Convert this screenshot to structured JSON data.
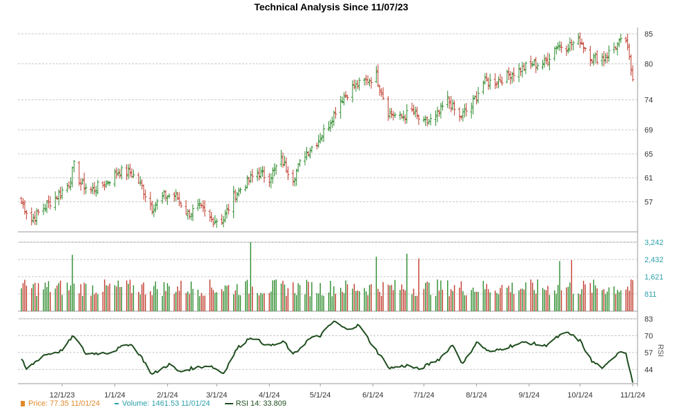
{
  "chart_data": {
    "title": "Technical Analysis Since 11/07/23",
    "type": "ohlc",
    "colors": {
      "up": "#2a8a2a",
      "down": "#c0392b",
      "rsi": "#1e4d1e",
      "price_label": "#e08a2a",
      "volume_label": "#2a9fa8",
      "grid": "#c8c8c8"
    },
    "price_panel": {
      "yticks": [
        57,
        61,
        65,
        69,
        74,
        80,
        85
      ],
      "ylim": [
        52,
        85
      ]
    },
    "volume_panel": {
      "yticks": [
        811,
        1621,
        2432,
        3242
      ],
      "ytick_labels": [
        "811",
        "1,621",
        "2,432",
        "3,242"
      ],
      "ylim": [
        0,
        3242
      ]
    },
    "rsi_panel": {
      "label": "RSI",
      "yticks": [
        44,
        57,
        70,
        83
      ],
      "ylim": [
        33,
        83
      ]
    },
    "x_ticks": [
      "12/1/23",
      "1/1/24",
      "2/1/24",
      "3/1/24",
      "4/1/24",
      "5/1/24",
      "6/1/24",
      "7/1/24",
      "8/1/24",
      "9/1/24",
      "10/1/24",
      "11/1/24"
    ],
    "price_anchors": [
      [
        "11/7/23",
        57
      ],
      [
        "11/13/23",
        54
      ],
      [
        "11/20/23",
        56
      ],
      [
        "11/28/23",
        58
      ],
      [
        "12/5/23",
        60
      ],
      [
        "12/8/23",
        63
      ],
      [
        "12/12/23",
        60
      ],
      [
        "12/18/23",
        59
      ],
      [
        "12/26/23",
        60
      ],
      [
        "1/3/24",
        62
      ],
      [
        "1/10/24",
        62
      ],
      [
        "1/16/24",
        60
      ],
      [
        "1/23/24",
        56
      ],
      [
        "1/30/24",
        58
      ],
      [
        "2/2/24",
        58
      ],
      [
        "2/6/24",
        58
      ],
      [
        "2/13/24",
        55
      ],
      [
        "2/20/24",
        56
      ],
      [
        "2/27/24",
        54
      ],
      [
        "3/5/24",
        54
      ],
      [
        "3/11/24",
        58
      ],
      [
        "3/18/24",
        60
      ],
      [
        "3/25/24",
        62
      ],
      [
        "4/1/24",
        61
      ],
      [
        "4/8/24",
        64
      ],
      [
        "4/15/24",
        61
      ],
      [
        "4/22/24",
        65
      ],
      [
        "4/29/24",
        67
      ],
      [
        "5/6/24",
        70
      ],
      [
        "5/13/24",
        74
      ],
      [
        "5/20/24",
        76
      ],
      [
        "5/27/24",
        77
      ],
      [
        "6/3/24",
        78
      ],
      [
        "6/10/24",
        72
      ],
      [
        "6/17/24",
        71
      ],
      [
        "6/24/24",
        72
      ],
      [
        "7/1/24",
        70
      ],
      [
        "7/8/24",
        71
      ],
      [
        "7/15/24",
        74
      ],
      [
        "7/22/24",
        71
      ],
      [
        "7/29/24",
        73
      ],
      [
        "8/5/24",
        77
      ],
      [
        "8/12/24",
        77
      ],
      [
        "8/19/24",
        78
      ],
      [
        "8/26/24",
        79
      ],
      [
        "9/3/24",
        80
      ],
      [
        "9/10/24",
        80
      ],
      [
        "9/17/24",
        83
      ],
      [
        "9/24/24",
        83
      ],
      [
        "10/1/24",
        84
      ],
      [
        "10/8/24",
        81
      ],
      [
        "10/15/24",
        81
      ],
      [
        "10/22/24",
        83
      ],
      [
        "10/28/24",
        84
      ],
      [
        "11/1/24",
        77.35
      ]
    ],
    "volume_spikes": [
      [
        "12/7/23",
        2650
      ],
      [
        "3/21/24",
        3242
      ],
      [
        "6/3/24",
        2560
      ],
      [
        "6/21/24",
        2700
      ],
      [
        "6/28/24",
        2480
      ],
      [
        "9/19/24",
        2350
      ],
      [
        "9/26/24",
        2400
      ],
      [
        "11/1/24",
        1461.53
      ]
    ],
    "rsi_anchors": [
      [
        "11/7/23",
        52
      ],
      [
        "11/10/23",
        44
      ],
      [
        "11/20/23",
        55
      ],
      [
        "11/30/23",
        58
      ],
      [
        "12/8/23",
        70
      ],
      [
        "12/15/23",
        56
      ],
      [
        "12/29/23",
        57
      ],
      [
        "1/10/24",
        64
      ],
      [
        "1/16/24",
        55
      ],
      [
        "1/23/24",
        40
      ],
      [
        "2/2/24",
        48
      ],
      [
        "2/8/24",
        42
      ],
      [
        "2/16/24",
        45
      ],
      [
        "2/26/24",
        47
      ],
      [
        "3/5/24",
        41
      ],
      [
        "3/13/24",
        60
      ],
      [
        "3/21/24",
        69
      ],
      [
        "4/1/24",
        62
      ],
      [
        "4/10/24",
        65
      ],
      [
        "4/15/24",
        55
      ],
      [
        "4/24/24",
        67
      ],
      [
        "5/1/24",
        70
      ],
      [
        "5/9/24",
        81
      ],
      [
        "5/16/24",
        75
      ],
      [
        "5/24/24",
        78
      ],
      [
        "6/1/24",
        62
      ],
      [
        "6/11/24",
        45
      ],
      [
        "6/21/24",
        47
      ],
      [
        "6/28/24",
        44
      ],
      [
        "7/10/24",
        52
      ],
      [
        "7/18/24",
        63
      ],
      [
        "7/24/24",
        48
      ],
      [
        "8/1/24",
        65
      ],
      [
        "8/9/24",
        57
      ],
      [
        "8/21/24",
        62
      ],
      [
        "8/30/24",
        65
      ],
      [
        "9/10/24",
        62
      ],
      [
        "9/19/24",
        70
      ],
      [
        "9/24/24",
        72
      ],
      [
        "10/1/24",
        66
      ],
      [
        "10/8/24",
        50
      ],
      [
        "10/15/24",
        45
      ],
      [
        "10/24/24",
        58
      ],
      [
        "10/28/24",
        57
      ],
      [
        "11/1/24",
        33.809
      ]
    ],
    "legend": {
      "price": {
        "label": "Price:",
        "value": "77.35",
        "date": "11/01/24"
      },
      "volume": {
        "label": "Volume:",
        "value": "1461.53",
        "date": "11/01/24"
      },
      "rsi": {
        "label": "RSI 14:",
        "value": "33.809"
      }
    }
  }
}
